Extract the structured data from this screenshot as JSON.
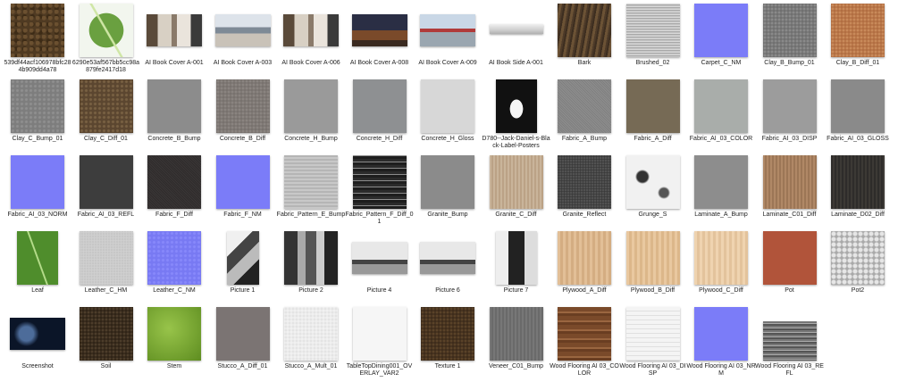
{
  "files": [
    {
      "name": "539df44acf106978bfc284b909dd4a78",
      "style": "full",
      "pattern": "p-soil"
    },
    {
      "name": "6290e53af567bb5cc98a879fe2417d18",
      "style": "full",
      "pattern": "p-leaf"
    },
    {
      "name": "AI Book Cover A-001",
      "style": "wide",
      "pattern": "p-room"
    },
    {
      "name": "AI Book Cover A-003",
      "style": "wide",
      "pattern": "p-room2"
    },
    {
      "name": "AI Book Cover A-006",
      "style": "wide",
      "pattern": "p-room"
    },
    {
      "name": "AI Book Cover A-008",
      "style": "wide",
      "pattern": "p-cabin"
    },
    {
      "name": "AI Book Cover A-009",
      "style": "wide",
      "pattern": "p-city"
    },
    {
      "name": "AI Book Side A-001",
      "style": "slim",
      "pattern": "p-strip"
    },
    {
      "name": "Bark",
      "style": "full",
      "pattern": "p-bark"
    },
    {
      "name": "Brushed_02",
      "style": "full",
      "pattern": "p-brushed"
    },
    {
      "name": "Carpet_C_NM",
      "style": "full",
      "pattern": "p-nm"
    },
    {
      "name": "Clay_B_Bump_01",
      "style": "full",
      "pattern": "p-bump"
    },
    {
      "name": "Clay_B_Diff_01",
      "style": "full",
      "pattern": "p-claydiff"
    },
    {
      "name": "Clay_C_Bump_01",
      "style": "full",
      "pattern": "p-claygray"
    },
    {
      "name": "Clay_C_Diff_01",
      "style": "full",
      "pattern": "p-claybrown"
    },
    {
      "name": "Concrete_B_Bump",
      "style": "full",
      "pattern": "p-conc-b"
    },
    {
      "name": "Concrete_B_Diff",
      "style": "full",
      "pattern": "p-conc-bd"
    },
    {
      "name": "Concrete_H_Bump",
      "style": "full",
      "pattern": "p-conc-h"
    },
    {
      "name": "Concrete_H_Diff",
      "style": "full",
      "pattern": "p-conc-hd"
    },
    {
      "name": "Concrete_H_Gloss",
      "style": "full",
      "pattern": "p-conc-hg"
    },
    {
      "name": "D780--Jack-Daniel-s-Black-Label-Posters",
      "style": "doc",
      "pattern": "p-jack"
    },
    {
      "name": "Fabric_A_Bump",
      "style": "full",
      "pattern": "p-fab-a"
    },
    {
      "name": "Fabric_A_Diff",
      "style": "full",
      "pattern": "p-fab-ad"
    },
    {
      "name": "Fabric_AI_03_COLOR",
      "style": "full",
      "pattern": "p-fab-col"
    },
    {
      "name": "Fabric_AI_03_DISP",
      "style": "full",
      "pattern": "p-fab-disp"
    },
    {
      "name": "Fabric_AI_03_GLOSS",
      "style": "full",
      "pattern": "p-fab-gloss"
    },
    {
      "name": "Fabric_AI_03_NORM",
      "style": "full",
      "pattern": "p-nm"
    },
    {
      "name": "Fabric_AI_03_REFL",
      "style": "full",
      "pattern": "p-fab-refl"
    },
    {
      "name": "Fabric_F_Diff",
      "style": "full",
      "pattern": "p-fab-f"
    },
    {
      "name": "Fabric_F_NM",
      "style": "full",
      "pattern": "p-nm"
    },
    {
      "name": "Fabric_Pattern_E_Bump",
      "style": "full",
      "pattern": "p-fabpat-b"
    },
    {
      "name": "Fabric_Pattern_F_Diff_01",
      "style": "full",
      "pattern": "p-fabpat-d"
    },
    {
      "name": "Granite_Bump",
      "style": "full",
      "pattern": "p-gran-b"
    },
    {
      "name": "Granite_C_Diff",
      "style": "full",
      "pattern": "p-gran-c"
    },
    {
      "name": "Granite_Reflect",
      "style": "full",
      "pattern": "p-gran-r"
    },
    {
      "name": "Grunge_S",
      "style": "full",
      "pattern": "p-grunge"
    },
    {
      "name": "Laminate_A_Bump",
      "style": "full",
      "pattern": "p-lam-a"
    },
    {
      "name": "Laminate_C01_Diff",
      "style": "full",
      "pattern": "p-lam-c01"
    },
    {
      "name": "Laminate_D02_Diff",
      "style": "full",
      "pattern": "p-lam-d02"
    },
    {
      "name": "Leaf",
      "style": "doc",
      "pattern": "p-leaf2"
    },
    {
      "name": "Leather_C_HM",
      "style": "full",
      "pattern": "p-leath-hm"
    },
    {
      "name": "Leather_C_NM",
      "style": "full",
      "pattern": "p-nm2"
    },
    {
      "name": "Picture 1",
      "style": "tall",
      "pattern": "p-bw"
    },
    {
      "name": "Picture 2",
      "style": "full",
      "pattern": "p-street"
    },
    {
      "name": "Picture 4",
      "style": "wide",
      "pattern": "p-sky"
    },
    {
      "name": "Picture 6",
      "style": "wide",
      "pattern": "p-sky"
    },
    {
      "name": "Picture 7",
      "style": "doc",
      "pattern": "p-phone"
    },
    {
      "name": "Plywood_A_Diff",
      "style": "full",
      "pattern": "p-ply-a"
    },
    {
      "name": "Plywood_B_Diff",
      "style": "full",
      "pattern": "p-ply-b"
    },
    {
      "name": "Plywood_C_Diff",
      "style": "full",
      "pattern": "p-ply-c"
    },
    {
      "name": "Pot",
      "style": "full",
      "pattern": "p-pot"
    },
    {
      "name": "Pot2",
      "style": "full",
      "pattern": "p-pot2"
    },
    {
      "name": "Screenshot",
      "style": "wide",
      "pattern": "p-shot"
    },
    {
      "name": "Soil",
      "style": "full",
      "pattern": "p-soil2"
    },
    {
      "name": "Stem",
      "style": "full",
      "pattern": "p-stem"
    },
    {
      "name": "Stucco_A_Diff_01",
      "style": "full",
      "pattern": "p-stucco-a"
    },
    {
      "name": "Stucco_A_Mult_01",
      "style": "full",
      "pattern": "p-stucco-m"
    },
    {
      "name": "TableTopDining001_OVERLAY_VAR2",
      "style": "full",
      "pattern": "p-table"
    },
    {
      "name": "Texture 1",
      "style": "full",
      "pattern": "p-tex1"
    },
    {
      "name": "Veneer_C01_Bump",
      "style": "full",
      "pattern": "p-veneer"
    },
    {
      "name": "Wood Flooring AI 03_COLOR",
      "style": "full",
      "pattern": "p-wood-col"
    },
    {
      "name": "Wood Flooring AI 03_DISP",
      "style": "full",
      "pattern": "p-wood-disp"
    },
    {
      "name": "Wood Flooring AI 03_NRM",
      "style": "full",
      "pattern": "p-wood-nrm"
    },
    {
      "name": "Wood Flooring AI 03_REFL",
      "style": "tile2",
      "pattern": "p-wood-refl"
    }
  ]
}
